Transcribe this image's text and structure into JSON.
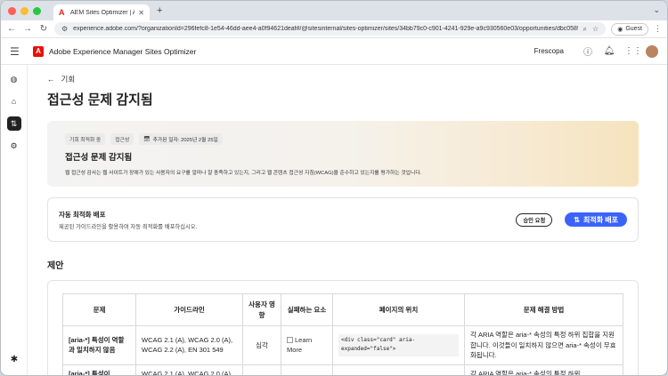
{
  "browser": {
    "tab_title": "AEM Sites Optimizer | Adobe",
    "url": "experience.adobe.com/?organizationId=296fefc8-1e54-46dd-aee4-a0f94621deaf#/@sitesinternal/sites-optimizer/sites/34bb79c0-c901-4241-929e-a9c930560e03/opportunities/dbc0589...",
    "guest_label": "Guest",
    "colors": {
      "close": "#ff5f57",
      "minimize": "#febc2e",
      "maximize": "#28c840"
    }
  },
  "app": {
    "title": "Adobe Experience Manager Sites Optimizer",
    "org": "Frescopa",
    "accent": "#3b63fb"
  },
  "page": {
    "back_label": "기회",
    "title": "접근성 문제 감지됨"
  },
  "hero": {
    "tags": [
      "기회 최적화 중",
      "접근성"
    ],
    "date_tag": "추가된 일자: 2025년 2월 25일",
    "title": "접근성 문제 감지됨",
    "description": "웹 접근성 감사는 웹 사이트가 장애가 있는 사용자의 요구를 얼마나 잘 충족하고 있는지, 그리고 웹 콘텐츠 접근성 지침(WCAG)을 준수하고 있는지를 평가하는 것입니다."
  },
  "deploy": {
    "title": "자동 최적화 배포",
    "subtitle": "제공된 가이드라인을 활용하여 자동 최적화를 배포하십시오.",
    "request_button": "승인 요청",
    "deploy_button": "최적화 배포"
  },
  "suggestions": {
    "section_title": "제안",
    "columns": [
      "문제",
      "가이드라인",
      "사용자 영향",
      "실패하는 요소",
      "페이지의 위치",
      "문제 해결 방법"
    ],
    "rows": [
      {
        "issue": "[aria-*] 특성이 역할과 일치하지 않음",
        "guideline": "WCAG 2.1 (A), WCAG 2.0 (A), WCAG 2.2 (A), EN 301 549",
        "impact": "심각",
        "element": "Learn More",
        "location": "<div class=\"card\" aria-expanded=\"false\">",
        "fix": "각 ARIA 역할은 aria-* 속성의 특정 하위 집합을 지원합니다. 이것들이 일치하지 않으면 aria-* 속성이 무효화됩니다."
      },
      {
        "issue": "[aria-*] 특성이",
        "guideline": "WCAG 2.1 (A), WCAG 2.0 (A),",
        "impact": "",
        "element": "",
        "location": "",
        "fix": "각 ARIA 역할은 aria-* 속성의 특정 하위"
      }
    ]
  }
}
